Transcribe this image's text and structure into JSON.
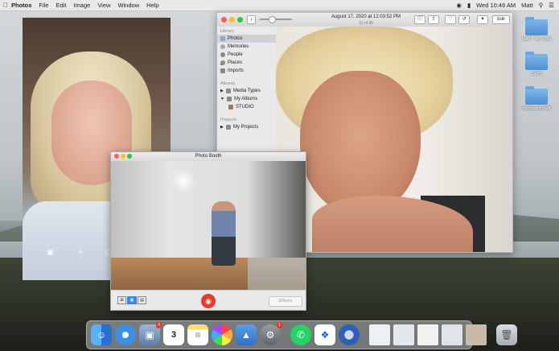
{
  "menubar": {
    "app": "Photos",
    "items": [
      "File",
      "Edit",
      "Image",
      "View",
      "Window",
      "Help"
    ],
    "clock": "Wed 10:46 AM",
    "user": "Matt"
  },
  "photos": {
    "title_date": "August 17, 2020 at 12:03:52 PM",
    "title_count": "31 of 85",
    "edit_label": "Edit",
    "sidebar": {
      "library_header": "Library",
      "library_items": [
        "Photos",
        "Memories",
        "People",
        "Places",
        "Imports"
      ],
      "albums_header": "Albums",
      "albums_items": [
        "Media Types",
        "My Albums",
        "STUDIO"
      ],
      "projects_header": "Projects",
      "projects_items": [
        "My Projects"
      ]
    }
  },
  "booth": {
    "title": "Photo Booth",
    "effects_label": "Effects"
  },
  "desktop_icons": [
    "MATT TAYLOR",
    "CATS",
    "important stuff"
  ],
  "dock": {
    "apps": [
      "finder-icon",
      "safari-icon",
      "preview-icon",
      "calendar-icon",
      "notes-icon",
      "photos-icon",
      "keynote-icon",
      "system-preferences-icon",
      "whatsapp-icon",
      "dropbox-icon",
      "quicktime-icon"
    ],
    "calendar_day": "3",
    "badges": {
      "preview": "4",
      "system_preferences": "1"
    }
  },
  "colors": {
    "accent": "#3b82f6",
    "record": "#e53b2f",
    "folder": "#5b9be0"
  }
}
